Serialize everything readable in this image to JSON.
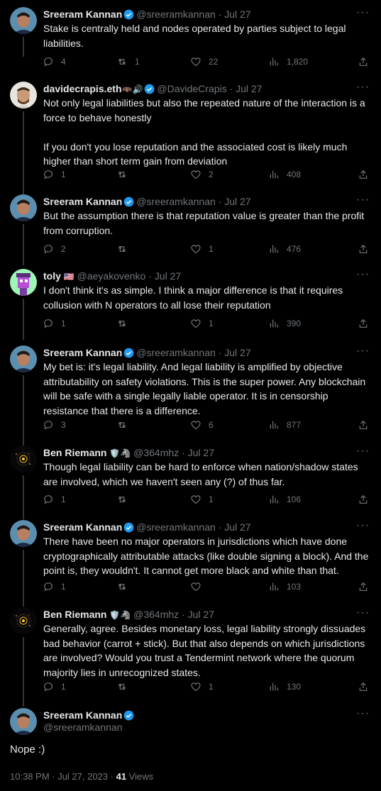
{
  "tweets": [
    {
      "name": "Sreeram Kannan",
      "handle": "@sreeramkannan",
      "date": "Jul 27",
      "verified": true,
      "text": "Stake is centrally held and nodes operated by parties subject to legal\nliabilities.",
      "replies": "4",
      "retweets": "1",
      "likes": "22",
      "views": "1,820"
    },
    {
      "name": "davidecrapis.eth",
      "name_emoji": "🦇🔊",
      "handle": "@DavideCrapis",
      "date": "Jul 27",
      "verified": true,
      "text": "Not only legal liabilities but also the repeated nature of the interaction is a\nforce to behave honestly\n\nIf you don't you lose reputation and the associated cost is likely much\nhigher than short term gain from deviation",
      "replies": "1",
      "retweets": "",
      "likes": "2",
      "views": "408"
    },
    {
      "name": "Sreeram Kannan",
      "handle": "@sreeramkannan",
      "date": "Jul 27",
      "verified": true,
      "text": "But the assumption there is that reputation value is greater than the profit\nfrom corruption.",
      "replies": "2",
      "retweets": "",
      "likes": "1",
      "views": "476"
    },
    {
      "name": "toly",
      "name_emoji": "🇺🇸",
      "handle": "@aeyakovenko",
      "date": "Jul 27",
      "verified": false,
      "text": "I don't think it's as simple. I think a major difference is that it requires\ncollusion with N operators to all lose their reputation",
      "replies": "1",
      "retweets": "",
      "likes": "1",
      "views": "390"
    },
    {
      "name": "Sreeram Kannan",
      "handle": "@sreeramkannan",
      "date": "Jul 27",
      "verified": true,
      "text": "My bet is: it's legal liability. And legal liability is amplified by objective\nattributability on safety violations. This is the super power. Any blockchain\nwill be safe with a single legally liable operator. It is in censorship\nresistance that there is a difference.",
      "replies": "3",
      "retweets": "",
      "likes": "6",
      "views": "877"
    },
    {
      "name": "Ben Riemann",
      "name_emoji": "🛡️🦓",
      "handle": "@364mhz",
      "date": "Jul 27",
      "verified": false,
      "text": "Though legal liability can be hard to enforce when nation/shadow states\nare involved, which we haven't seen any (?) of thus far.",
      "replies": "1",
      "retweets": "",
      "likes": "1",
      "views": "106"
    },
    {
      "name": "Sreeram Kannan",
      "handle": "@sreeramkannan",
      "date": "Jul 27",
      "verified": true,
      "text": "There have been no major operators in jurisdictions which have done\ncryptographically attributable attacks (like double signing a block). And the\npoint is, they wouldn't. It cannot get more black and white than that.",
      "replies": "1",
      "retweets": "",
      "likes": "",
      "views": "103"
    },
    {
      "name": "Ben Riemann",
      "name_emoji": "🛡️🦓",
      "handle": "@364mhz",
      "date": "Jul 27",
      "verified": false,
      "text": "Generally, agree. Besides monetary loss, legal liability strongly dissuades\nbad behavior (carrot + stick). But that also depends on which jurisdictions\nare involved? Would you trust a Tendermint network where the quorum\nmajority lies in unrecognized states.",
      "replies": "1",
      "retweets": "",
      "likes": "1",
      "views": "130"
    }
  ],
  "main_tweet": {
    "name": "Sreeram Kannan",
    "handle": "@sreeramkannan",
    "verified": true,
    "text": "Nope :)",
    "timestamp": "10:38 PM · Jul 27, 2023 · ",
    "views_count": "41",
    "views_label": " Views"
  },
  "colors": {
    "background": "#000000",
    "text": "#e7e9ea",
    "muted": "#71767b",
    "verified": "#1d9bf0"
  }
}
